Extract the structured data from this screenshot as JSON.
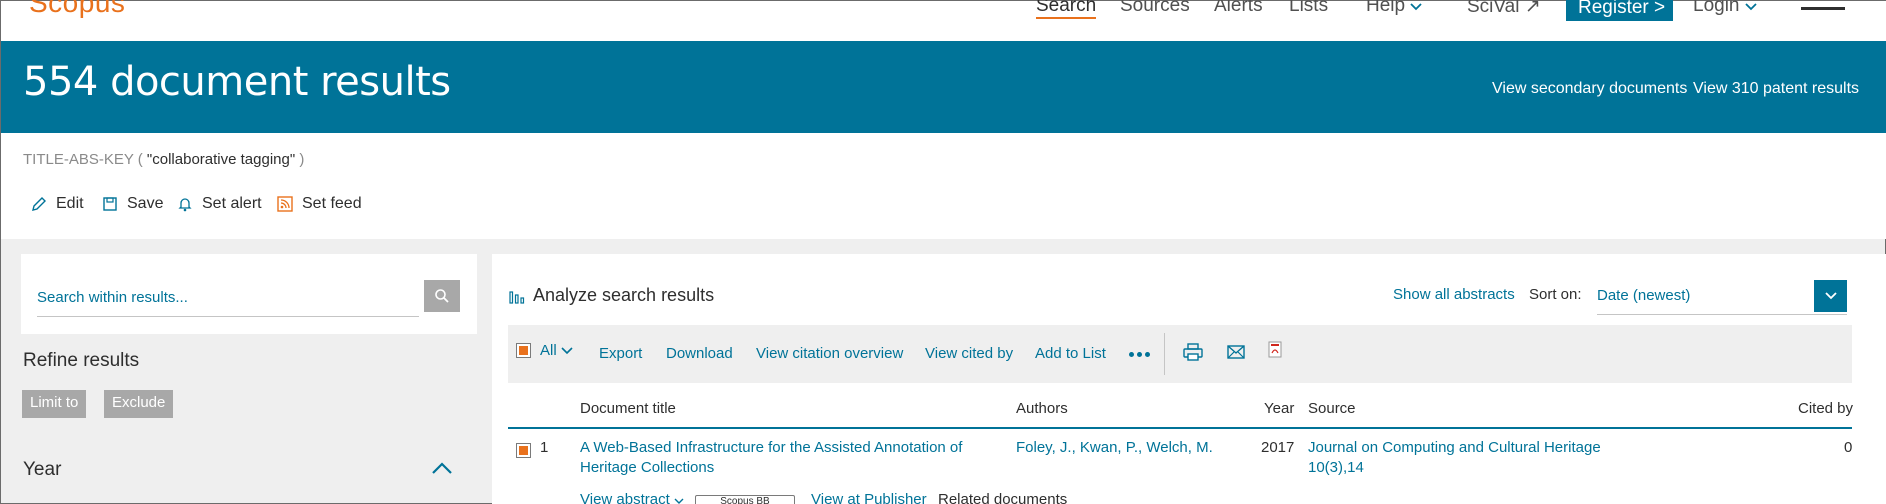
{
  "topnav": {
    "logo": "Scopus",
    "items": [
      "Search",
      "Sources",
      "Alerts",
      "Lists",
      "Help",
      "SciVal ↗"
    ],
    "register": "Register >",
    "login": "Login"
  },
  "banner": {
    "title": "554 document results",
    "secondary_link": "View secondary documents",
    "patent_link": "View 310 patent results"
  },
  "query": {
    "field": "TITLE-ABS-KEY (",
    "term": " \"collaborative tagging\"",
    "close": " )"
  },
  "actions": {
    "edit": "Edit",
    "save": "Save",
    "set_alert": "Set alert",
    "set_feed": "Set feed"
  },
  "refine": {
    "search_placeholder": "Search within results...",
    "title": "Refine results",
    "limit_to": "Limit to",
    "exclude": "Exclude",
    "year": "Year"
  },
  "results": {
    "analyze": "Analyze search results",
    "show_all_abstracts": "Show all abstracts",
    "sort_label": "Sort on:",
    "sort_value": "Date (newest)",
    "toolbar": {
      "all": "All",
      "export": "Export",
      "download": "Download",
      "citation_overview": "View citation overview",
      "view_cited_by": "View cited by",
      "add_to_list": "Add to List"
    },
    "columns": {
      "title": "Document title",
      "authors": "Authors",
      "year": "Year",
      "source": "Source",
      "cited_by": "Cited by"
    },
    "rows": [
      {
        "index": "1",
        "title": "A Web-Based Infrastructure for the Assisted Annotation of Heritage Collections",
        "authors": "Foley, J., Kwan, P., Welch, M.",
        "year": "2017",
        "source": "Journal on Computing and Cultural Heritage 10(3),14",
        "cited_by": "0",
        "view_abstract": "View abstract",
        "scopus_btn": "Scopus BB",
        "view_at_publisher": "View at Publisher",
        "related": "Related documents"
      }
    ]
  },
  "colors": {
    "brand_blue": "#007398",
    "accent_orange": "#e9711c"
  }
}
